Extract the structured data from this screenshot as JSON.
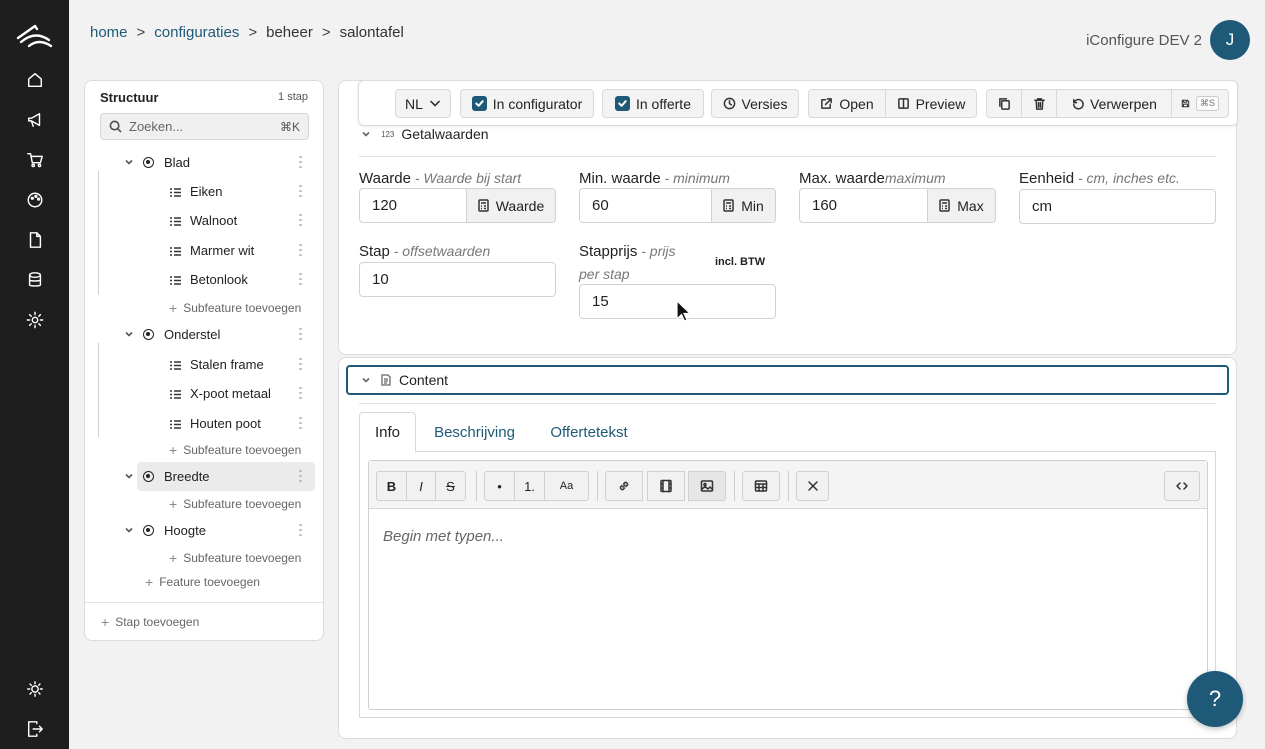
{
  "breadcrumb": {
    "home": "home",
    "configuraties": "configuraties",
    "beheer": "beheer",
    "current": "salontafel",
    "sep": ">"
  },
  "header": {
    "env": "iConfigure DEV 2",
    "avatar": "J"
  },
  "structure": {
    "title": "Structuur",
    "count": "1 stap",
    "search_placeholder": "Zoeken...",
    "search_shortcut": "⌘K",
    "features": [
      {
        "label": "Blad",
        "options": [
          "Eiken",
          "Walnoot",
          "Marmer wit",
          "Betonlook"
        ],
        "add": "Subfeature toevoegen"
      },
      {
        "label": "Onderstel",
        "options": [
          "Stalen frame",
          "X-poot metaal",
          "Houten poot"
        ],
        "add": "Subfeature toevoegen"
      },
      {
        "label": "Breedte",
        "options": [],
        "add": "Subfeature toevoegen"
      },
      {
        "label": "Hoogte",
        "options": [],
        "add": "Subfeature toevoegen"
      }
    ],
    "add_feature": "Feature toevoegen",
    "add_step": "Stap toevoegen"
  },
  "toolbar": {
    "language": "NL",
    "in_configurator": "In configurator",
    "in_offerte": "In offerte",
    "versies": "Versies",
    "open": "Open",
    "preview": "Preview",
    "verwerpen": "Verwerpen",
    "save_shortcut": "⌘S"
  },
  "getalwaarden": {
    "icon_text": "123",
    "title": "Getalwaarden",
    "waarde": {
      "label": "Waarde",
      "hint": " - Waarde bij start",
      "value": "120",
      "addon": "Waarde"
    },
    "min": {
      "label": "Min. waarde",
      "hint": " - minimum",
      "value": "60",
      "addon": "Min"
    },
    "max": {
      "label": "Max. waarde",
      "hint": "maximum",
      "value": "160",
      "addon": "Max"
    },
    "eenheid": {
      "label": "Eenheid",
      "hint": " - cm, inches etc.",
      "value": "cm"
    },
    "stap": {
      "label": "Stap",
      "hint": " - offsetwaarden",
      "value": "10"
    },
    "stapprijs": {
      "label": "Stapprijs",
      "hint1": " - prijs",
      "hint2": "per stap",
      "value": "15",
      "btw": "incl. BTW"
    }
  },
  "content": {
    "title": "Content",
    "tabs": [
      "Info",
      "Beschrijving",
      "Offertetekst"
    ],
    "editor": {
      "bold": "B",
      "italic": "I",
      "strike": "S",
      "bullet": "•",
      "ordered": "1.",
      "fontsize": "Aa",
      "placeholder": "Begin met typen..."
    }
  },
  "help": "?",
  "colors": {
    "accent": "#1e5a78",
    "rail": "#1e1e1e"
  }
}
